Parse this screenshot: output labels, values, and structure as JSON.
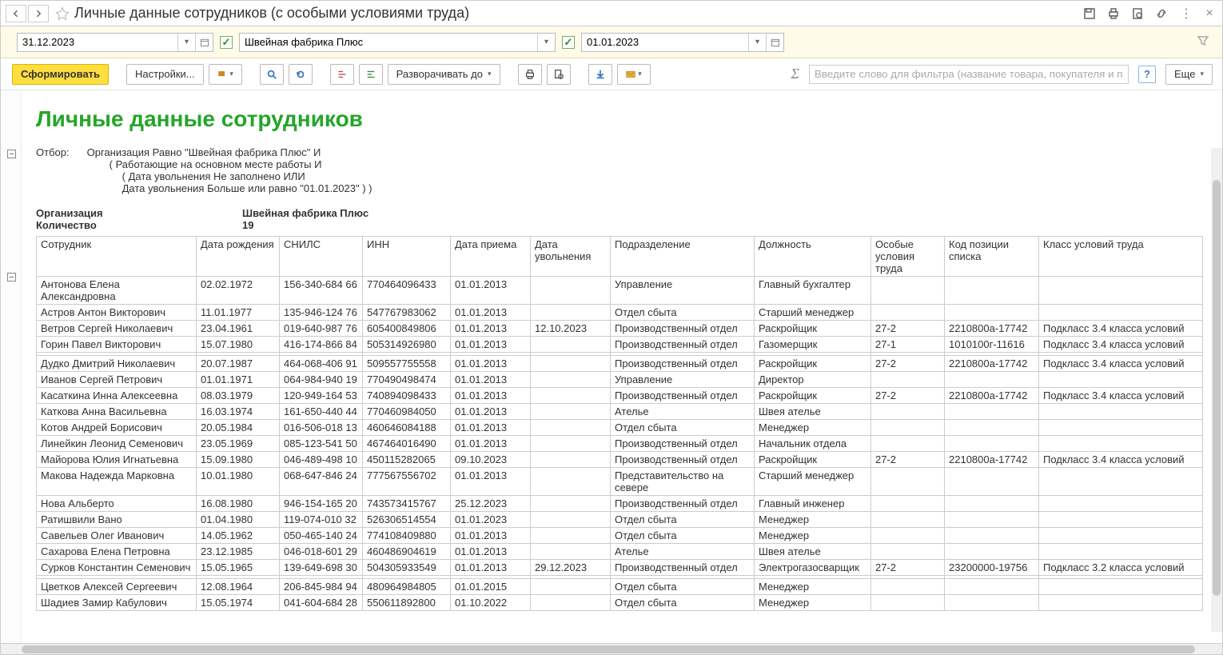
{
  "title": "Личные данные сотрудников (с особыми условиями труда)",
  "filters": {
    "date_end": "31.12.2023",
    "org": "Швейная фабрика Плюс",
    "date_start": "01.01.2023"
  },
  "toolbar": {
    "generate": "Сформировать",
    "settings": "Настройки...",
    "expand": "Разворачивать до",
    "filter_placeholder": "Введите слово для фильтра (название товара, покупателя и пр.)",
    "more": "Еще"
  },
  "report": {
    "title": "Личные данные сотрудников",
    "filter_label": "Отбор:",
    "filter_lines": [
      "Организация Равно \"Швейная фабрика Плюс\" И",
      "( Работающие на основном месте работы И",
      "( Дата увольнения Не заполнено ИЛИ",
      "Дата увольнения Больше или равно \"01.01.2023\" ) )"
    ],
    "summary": {
      "org_label": "Организация",
      "org_value": "Швейная фабрика Плюс",
      "count_label": "Количество",
      "count_value": "19"
    },
    "columns": [
      "Сотрудник",
      "Дата рождения",
      "СНИЛС",
      "ИНН",
      "Дата приема",
      "Дата увольнения",
      "Подразделение",
      "Должность",
      "Особые условия труда",
      "Код позиции списка",
      "Класс условий труда"
    ],
    "rows": [
      [
        "Антонова Елена Александровна",
        "02.02.1972",
        "156-340-684 66",
        "770464096433",
        "01.01.2013",
        "",
        "Управление",
        "Главный бухгалтер",
        "",
        "",
        ""
      ],
      [
        "Астров Антон Викторович",
        "11.01.1977",
        "135-946-124 76",
        "547767983062",
        "01.01.2013",
        "",
        "Отдел сбыта",
        "Старший менеджер",
        "",
        "",
        ""
      ],
      [
        "Ветров Сергей Николаевич",
        "23.04.1961",
        "019-640-987 76",
        "605400849806",
        "01.01.2013",
        "12.10.2023",
        "Производственный отдел",
        "Раскройщик",
        "27-2",
        "2210800а-17742",
        "Подкласс 3.4 класса условий"
      ],
      [
        "Горин Павел Викторович",
        "15.07.1980",
        "416-174-866 84",
        "505314926980",
        "01.01.2013",
        "",
        "Производственный отдел",
        "Газомерщик",
        "27-1",
        "1010100г-11616",
        "Подкласс 3.4 класса условий"
      ],
      "sep",
      [
        "Дудко Дмитрий Николаевич",
        "20.07.1987",
        "464-068-406 91",
        "509557755558",
        "01.01.2013",
        "",
        "Производственный отдел",
        "Раскройщик",
        "27-2",
        "2210800а-17742",
        "Подкласс 3.4 класса условий"
      ],
      [
        "Иванов Сергей Петрович",
        "01.01.1971",
        "064-984-940 19",
        "770490498474",
        "01.01.2013",
        "",
        "Управление",
        "Директор",
        "",
        "",
        ""
      ],
      [
        "Касаткина Инна Алексеевна",
        "08.03.1979",
        "120-949-164 53",
        "740894098433",
        "01.01.2013",
        "",
        "Производственный отдел",
        "Раскройщик",
        "27-2",
        "2210800а-17742",
        "Подкласс 3.4 класса условий"
      ],
      [
        "Каткова Анна Васильевна",
        "16.03.1974",
        "161-650-440 44",
        "770460984050",
        "01.01.2013",
        "",
        "Ателье",
        "Швея ателье",
        "",
        "",
        ""
      ],
      [
        "Котов Андрей Борисович",
        "20.05.1984",
        "016-506-018 13",
        "460646084188",
        "01.01.2013",
        "",
        "Отдел сбыта",
        "Менеджер",
        "",
        "",
        ""
      ],
      [
        "Линейкин Леонид Семенович",
        "23.05.1969",
        "085-123-541 50",
        "467464016490",
        "01.01.2013",
        "",
        "Производственный отдел",
        "Начальник отдела",
        "",
        "",
        ""
      ],
      [
        "Майорова Юлия Игнатьевна",
        "15.09.1980",
        "046-489-498 10",
        "450115282065",
        "09.10.2023",
        "",
        "Производственный отдел",
        "Раскройщик",
        "27-2",
        "2210800а-17742",
        "Подкласс 3.4 класса условий"
      ],
      [
        "Макова Надежда Марковна",
        "10.01.1980",
        "068-647-846 24",
        "777567556702",
        "01.01.2013",
        "",
        "Представительство на севере",
        "Старший менеджер",
        "",
        "",
        ""
      ],
      [
        "Нова Альберто",
        "16.08.1980",
        "946-154-165 20",
        "743573415767",
        "25.12.2023",
        "",
        "Производственный отдел",
        "Главный инженер",
        "",
        "",
        ""
      ],
      [
        "Ратишвили Вано",
        "01.04.1980",
        "119-074-010 32",
        "526306514554",
        "01.01.2023",
        "",
        "Отдел сбыта",
        "Менеджер",
        "",
        "",
        ""
      ],
      [
        "Савельев Олег Иванович",
        "14.05.1962",
        "050-465-140 24",
        "774108409880",
        "01.01.2013",
        "",
        "Отдел сбыта",
        "Менеджер",
        "",
        "",
        ""
      ],
      [
        "Сахарова Елена Петровна",
        "23.12.1985",
        "046-018-601 29",
        "460486904619",
        "01.01.2013",
        "",
        "Ателье",
        "Швея ателье",
        "",
        "",
        ""
      ],
      [
        "Сурков Константин Семенович",
        "15.05.1965",
        "139-649-698 30",
        "504305933549",
        "01.01.2013",
        "29.12.2023",
        "Производственный отдел",
        "Электрогазосварщик",
        "27-2",
        "23200000-19756",
        "Подкласс 3.2 класса условий"
      ],
      "sep",
      [
        "Цветков Алексей Сергеевич",
        "12.08.1964",
        "206-845-984 94",
        "480964984805",
        "01.01.2015",
        "",
        "Отдел сбыта",
        "Менеджер",
        "",
        "",
        ""
      ],
      [
        "Шадиев Замир Кабулович",
        "15.05.1974",
        "041-604-684 28",
        "550611892800",
        "01.10.2022",
        "",
        "Отдел сбыта",
        "Менеджер",
        "",
        "",
        ""
      ]
    ]
  }
}
